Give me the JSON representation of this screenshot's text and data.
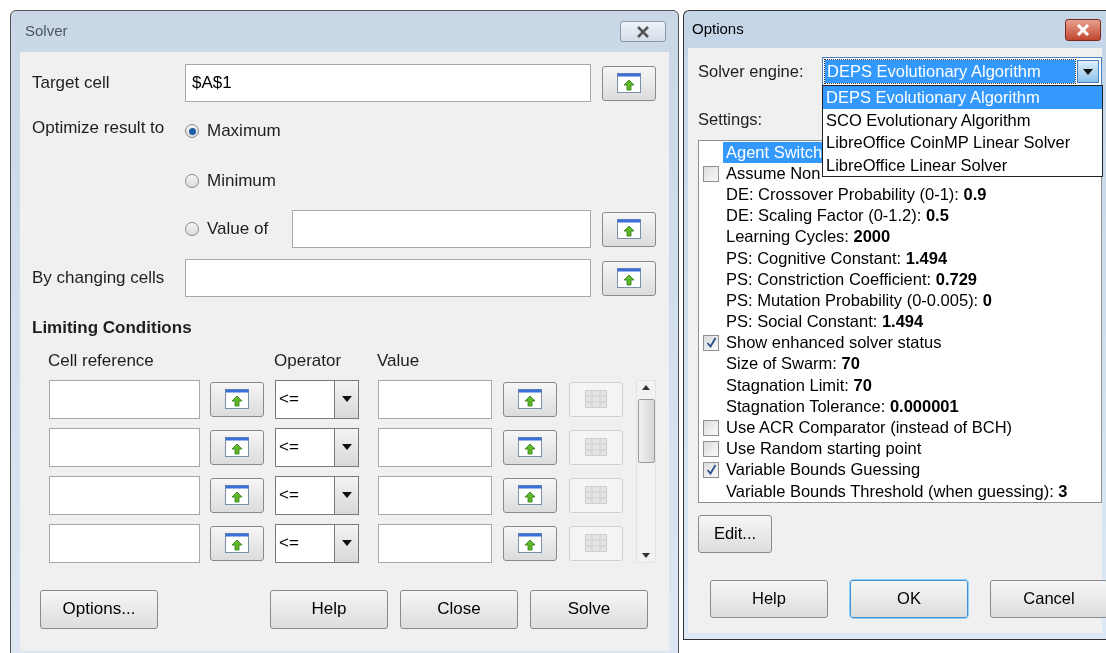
{
  "solver_dialog": {
    "title": "Solver",
    "target_cell": {
      "label": "Target cell",
      "value": "$A$1"
    },
    "optimize": {
      "label": "Optimize result to",
      "options": [
        {
          "kind": "plain",
          "label": "Maximum",
          "selected": true
        },
        {
          "kind": "plain",
          "label": "Minimum",
          "selected": false
        },
        {
          "kind": "with_field",
          "label": "Value of",
          "selected": false
        }
      ]
    },
    "changing_cells": {
      "label": "By changing cells"
    },
    "limiting_conditions": {
      "title": "Limiting Conditions",
      "columns": [
        "Cell reference",
        "Operator",
        "Value"
      ],
      "rows": [
        {
          "operator": "<="
        },
        {
          "operator": "<="
        },
        {
          "operator": "<="
        },
        {
          "operator": "<="
        }
      ]
    },
    "buttons": [
      "Options...",
      "Help",
      "Close",
      "Solve"
    ]
  },
  "options_dialog": {
    "title": "Options",
    "solver_engine": {
      "label": "Solver engine:",
      "value": "DEPS Evolutionary Algorithm",
      "expanded": true,
      "options": [
        {
          "label": "DEPS Evolutionary Algorithm",
          "selected": true
        },
        {
          "label": "SCO Evolutionary Algorithm",
          "selected": false
        },
        {
          "label": "LibreOffice CoinMP Linear Solver",
          "selected": false
        },
        {
          "label": "LibreOffice Linear Solver",
          "selected": false
        }
      ]
    },
    "settings": {
      "label": "Settings:",
      "items": [
        {
          "kind": "plain",
          "text": "Agent Switch",
          "selected": true
        },
        {
          "kind": "checkbox",
          "text": "Assume Non",
          "checked": false,
          "selected": false
        },
        {
          "kind": "plain",
          "text": "DE: Crossover Probability (0-1): **0.9**",
          "selected": false
        },
        {
          "kind": "plain",
          "text": "DE: Scaling Factor (0-1.2): **0.5**",
          "selected": false
        },
        {
          "kind": "plain",
          "text": "Learning Cycles: **2000**",
          "selected": false
        },
        {
          "kind": "plain",
          "text": "PS: Cognitive Constant: **1.494**",
          "selected": false
        },
        {
          "kind": "plain",
          "text": "PS: Constriction Coefficient: **0.729**",
          "selected": false
        },
        {
          "kind": "plain",
          "text": "PS: Mutation Probability (0-0.005): **0**",
          "selected": false
        },
        {
          "kind": "plain",
          "text": "PS: Social Constant: **1.494**",
          "selected": false
        },
        {
          "kind": "checkbox",
          "text": "Show enhanced solver status",
          "checked": true,
          "selected": false
        },
        {
          "kind": "plain",
          "text": "Size of Swarm: **70**",
          "selected": false
        },
        {
          "kind": "plain",
          "text": "Stagnation Limit: **70**",
          "selected": false
        },
        {
          "kind": "plain",
          "text": "Stagnation Tolerance: **0.000001**",
          "selected": false
        },
        {
          "kind": "checkbox",
          "text": "Use ACR Comparator (instead of BCH)",
          "checked": false,
          "selected": false
        },
        {
          "kind": "checkbox",
          "text": "Use Random starting point",
          "checked": false,
          "selected": false
        },
        {
          "kind": "checkbox",
          "text": "Variable Bounds Guessing",
          "checked": true,
          "selected": false
        },
        {
          "kind": "plain",
          "text": "Variable Bounds Threshold (when guessing): **3**",
          "selected": false
        }
      ]
    },
    "edit_button": "Edit...",
    "buttons": [
      {
        "label": "Help",
        "default": false
      },
      {
        "label": "OK",
        "default": true
      },
      {
        "label": "Cancel",
        "default": false
      }
    ]
  }
}
